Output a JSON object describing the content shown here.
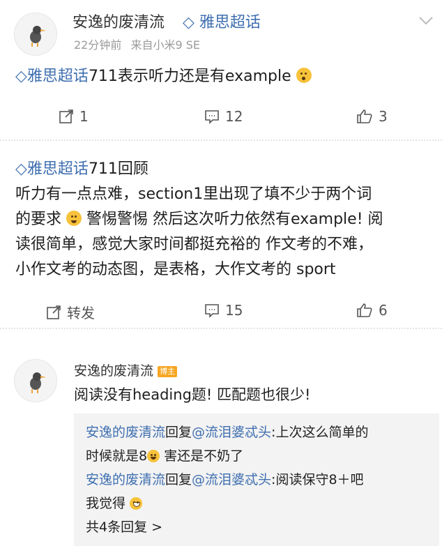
{
  "post1": {
    "author": "安逸的废清流",
    "topic_tag": "雅思超话",
    "time": "22分钟前",
    "source": "来自小米9 SE",
    "text_topic": "雅思超话",
    "text_body": "711表示听力还是有example",
    "repost_count": "1",
    "comment_count": "12",
    "like_count": "3"
  },
  "post2": {
    "text_topic": "雅思超话",
    "line1_rest": "711回顾",
    "line2": "听力有一点点难，section1里出现了填不少于两个词",
    "line3a": "的要求",
    "line3b": "警惕警惕 然后这次听力依然有example! 阅",
    "line4": "读很简单，感觉大家时间都挺充裕的 作文考的不难，",
    "line5": "小作文考的动态图，是表格，大作文考的 sport",
    "repost_label": "转发",
    "comment_count": "15",
    "like_count": "6"
  },
  "comment": {
    "author": "安逸的废清流",
    "badge": "博主",
    "text": "阅读没有heading题! 匹配题也很少!",
    "replies": [
      {
        "from": "安逸的废清流",
        "verb": "回复",
        "to": "@流泪婆忒头",
        "text_a": ":上次这么简单的",
        "text_b": "时候就是8",
        "text_c": " 害还是不奶了"
      },
      {
        "from": "安逸的废清流",
        "verb": "回复",
        "to": "@流泪婆忒头",
        "text_a": ":阅读保守8＋吧",
        "text_b": "我觉得"
      }
    ],
    "more_replies": "共4条回复 >"
  },
  "colors": {
    "link": "#3f6fb0",
    "muted": "#8f8f8f",
    "badge": "#f6a623"
  }
}
